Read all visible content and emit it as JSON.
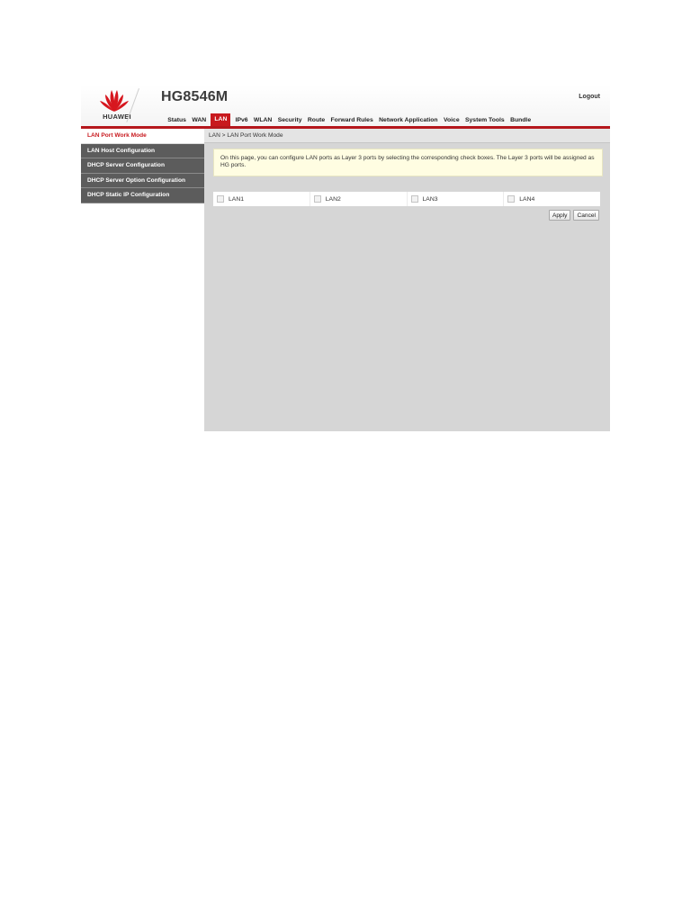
{
  "header": {
    "brand": "HUAWEI",
    "model": "HG8546M",
    "logout_label": "Logout"
  },
  "nav": {
    "items": [
      {
        "label": "Status"
      },
      {
        "label": "WAN"
      },
      {
        "label": "LAN",
        "active": true
      },
      {
        "label": "IPv6"
      },
      {
        "label": "WLAN"
      },
      {
        "label": "Security"
      },
      {
        "label": "Route"
      },
      {
        "label": "Forward Rules"
      },
      {
        "label": "Network Application"
      },
      {
        "label": "Voice"
      },
      {
        "label": "System Tools"
      },
      {
        "label": "Bundle"
      }
    ]
  },
  "sidebar": {
    "items": [
      {
        "label": "LAN Port Work Mode",
        "active": true
      },
      {
        "label": "LAN Host Configuration"
      },
      {
        "label": "DHCP Server Configuration"
      },
      {
        "label": "DHCP Server Option Configuration"
      },
      {
        "label": "DHCP Static IP Configuration"
      }
    ]
  },
  "main": {
    "breadcrumb": "LAN > LAN Port Work Mode",
    "info_text": "On this page, you can configure LAN ports as Layer 3 ports by selecting the corresponding check boxes. The Layer 3 ports will be assigned as HG ports.",
    "ports": [
      {
        "label": "LAN1",
        "checked": false
      },
      {
        "label": "LAN2",
        "checked": false
      },
      {
        "label": "LAN3",
        "checked": false
      },
      {
        "label": "LAN4",
        "checked": false
      }
    ],
    "apply_label": "Apply",
    "cancel_label": "Cancel"
  },
  "colors": {
    "brand_red": "#c8191e",
    "sidebar_dark": "#5c5c5c",
    "content_bg": "#d6d6d6",
    "info_bg": "#fffde2"
  }
}
